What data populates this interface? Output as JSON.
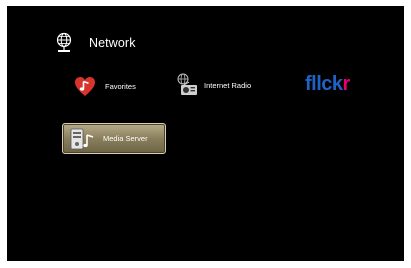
{
  "header": {
    "title": "Network",
    "icon": "globe-network-icon"
  },
  "menu": {
    "favorites": {
      "label": "Favorites",
      "icon": "heart-music-note-icon"
    },
    "internet_radio": {
      "label": "Internet Radio",
      "icon": "globe-radio-icon"
    },
    "flickr": {
      "logo_part1": "fllck",
      "logo_part2": "r",
      "icon": "flickr-logo"
    },
    "media_server": {
      "label": "Media Server",
      "icon": "media-server-icon",
      "selected": true
    }
  },
  "colors": {
    "background": "#000000",
    "flickr_blue": "#1e62c6",
    "flickr_pink": "#e8006e",
    "selection": "#8a7f5c"
  }
}
